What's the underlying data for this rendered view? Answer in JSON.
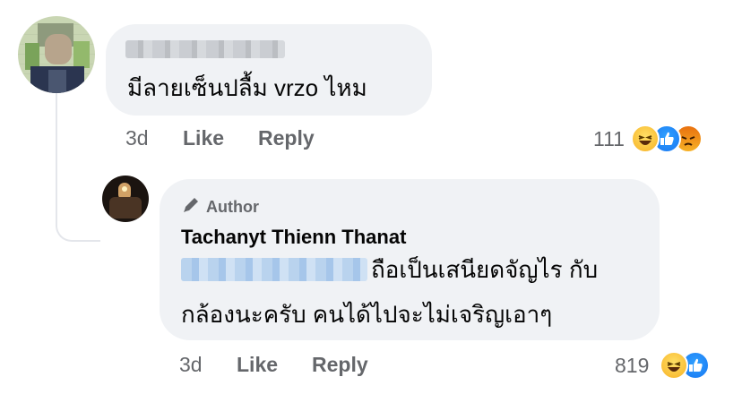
{
  "comment1": {
    "text": "มีลายเซ็นปลื้ม vrzo ไหม",
    "time": "3d",
    "like_label": "Like",
    "reply_label": "Reply",
    "reaction_count": "111",
    "reactions": [
      "haha-icon",
      "like-icon",
      "angry-icon"
    ]
  },
  "reply1": {
    "author_badge": "Author",
    "author_name": "Tachanyt Thienn Thanat",
    "text_line1": "ถือเป็นเสนียดจัญไร กับ",
    "text_line2": "กล้องนะครับ คนได้ไปจะไม่เจริญเอาๆ",
    "time": "3d",
    "like_label": "Like",
    "reply_label": "Reply",
    "reaction_count": "819",
    "reactions": [
      "haha-icon",
      "like-icon"
    ]
  },
  "colors": {
    "bubble": "#f0f2f5",
    "meta_text": "#65676b",
    "like_blue": "#1877f2",
    "haha_yellow": "#f7b125",
    "angry_orange": "#e9710f"
  }
}
